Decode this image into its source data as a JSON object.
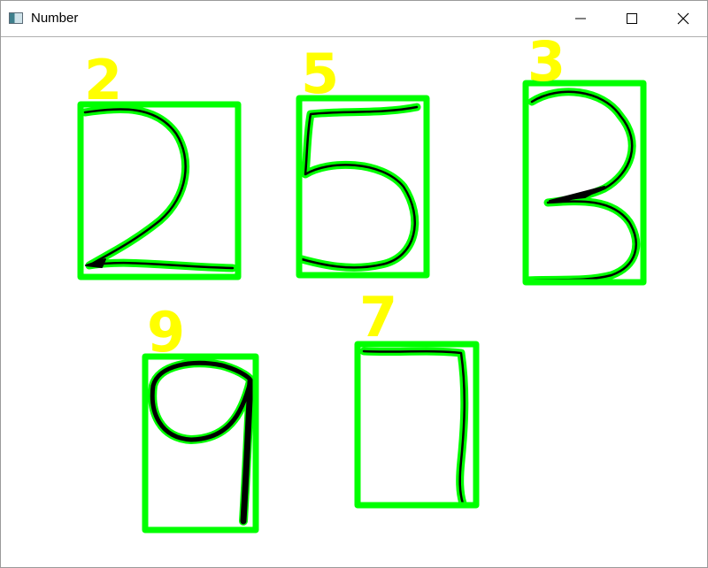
{
  "window": {
    "title": "Number",
    "icon": "app-window-icon",
    "controls": [
      "minimize-icon",
      "maximize-icon",
      "close-icon"
    ]
  },
  "colors": {
    "box": "#00ff00",
    "label": "#ffff00",
    "stroke": "#000000",
    "background": "#ffffff"
  },
  "detections": [
    {
      "label": "2"
    },
    {
      "label": "5"
    },
    {
      "label": "3"
    },
    {
      "label": "9"
    },
    {
      "label": "7"
    }
  ]
}
